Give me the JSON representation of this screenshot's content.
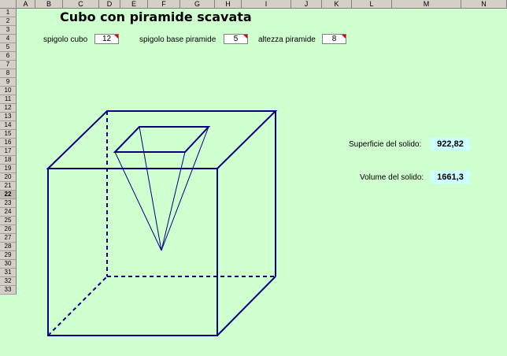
{
  "sheet": {
    "columns": [
      "A",
      "B",
      "C",
      "D",
      "E",
      "F",
      "G",
      "H",
      "I",
      "J",
      "K",
      "L",
      "M",
      "N"
    ],
    "rows": [
      "1",
      "2",
      "3",
      "4",
      "5",
      "6",
      "7",
      "8",
      "9",
      "10",
      "11",
      "12",
      "13",
      "14",
      "15",
      "16",
      "17",
      "18",
      "19",
      "20",
      "21",
      "22",
      "23",
      "24",
      "25",
      "26",
      "27",
      "28",
      "29",
      "30",
      "31",
      "32",
      "33"
    ],
    "active_row": "22"
  },
  "title": "Cubo con piramide scavata",
  "inputs": {
    "cube_edge_label": "spigolo cubo",
    "cube_edge_value": "12",
    "pyramid_base_label": "spigolo base piramide",
    "pyramid_base_value": "5",
    "pyramid_height_label": "altezza piramide",
    "pyramid_height_value": "8"
  },
  "results": {
    "surface_label": "Superficie del solido:",
    "surface_value": "922,82",
    "volume_label": "Volume del solido:",
    "volume_value": "1661,3"
  },
  "colors": {
    "background": "#cfffcf",
    "drawing_line": "#000080",
    "result_box": "#ccffff",
    "comment_marker": "#e00000"
  }
}
